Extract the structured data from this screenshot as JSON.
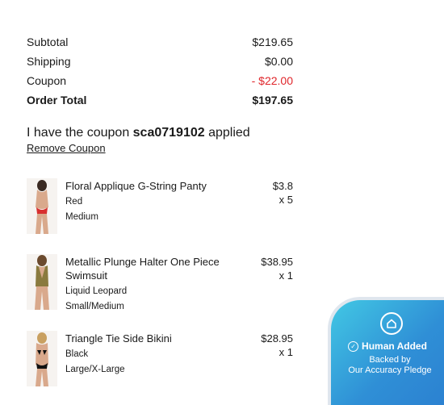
{
  "summary": {
    "subtotal_label": "Subtotal",
    "subtotal_value": "$219.65",
    "shipping_label": "Shipping",
    "shipping_value": "$0.00",
    "coupon_label": "Coupon",
    "coupon_value": "- $22.00",
    "total_label": "Order Total",
    "total_value": "$197.65"
  },
  "coupon": {
    "prefix": "I have the coupon ",
    "code": "sca0719102",
    "suffix": " applied",
    "remove_label": "Remove Coupon"
  },
  "items": [
    {
      "name": "Floral Applique G-String Panty",
      "color": "Red",
      "size": "Medium",
      "price": "$3.8",
      "qty": "x 5"
    },
    {
      "name": "Metallic Plunge Halter One Piece Swimsuit",
      "color": "Liquid Leopard",
      "size": "Small/Medium",
      "price": "$38.95",
      "qty": "x 1"
    },
    {
      "name": "Triangle Tie Side Bikini",
      "color": "Black",
      "size": "Large/X-Large",
      "price": "$28.95",
      "qty": "x 1"
    }
  ],
  "badge": {
    "icon": "home-icon",
    "title": "Human Added",
    "sub_line1": "Backed by",
    "sub_line2": "Our Accuracy Pledge"
  },
  "colors": {
    "coupon_red": "#e0262b",
    "badge_blue": "#2f8fd6",
    "badge_cyan": "#42c8e4"
  }
}
